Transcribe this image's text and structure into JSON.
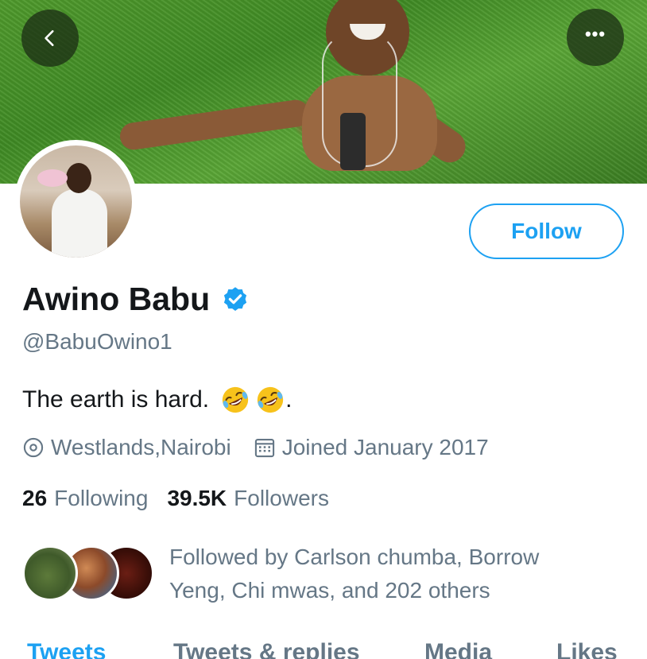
{
  "nav": {
    "back_icon": "chevron-left-icon",
    "more_label": "•••"
  },
  "profile": {
    "display_name": "Awino Babu",
    "verified_icon": "verified-badge-icon",
    "handle": "@BabuOwino1",
    "bio": "The earth is hard.",
    "bio_suffix": ".",
    "bio_emoji": [
      "rolling-on-floor-laughing",
      "rolling-on-floor-laughing"
    ],
    "location": "Westlands,Nairobi",
    "joined": "Joined January 2017",
    "follow_label": "Follow"
  },
  "stats": {
    "following_count": "26",
    "following_label": "Following",
    "followers_count": "39.5K",
    "followers_label": "Followers"
  },
  "followed_by": {
    "text": "Followed by Carlson chumba, Borrow Yeng, Chi mwas, and 202 others"
  },
  "tabs": [
    {
      "label": "Tweets",
      "active": true
    },
    {
      "label": "Tweets & replies",
      "active": false
    },
    {
      "label": "Media",
      "active": false
    },
    {
      "label": "Likes",
      "active": false
    }
  ],
  "colors": {
    "accent": "#1da1f2",
    "secondary_text": "#657786",
    "primary_text": "#14171a"
  }
}
